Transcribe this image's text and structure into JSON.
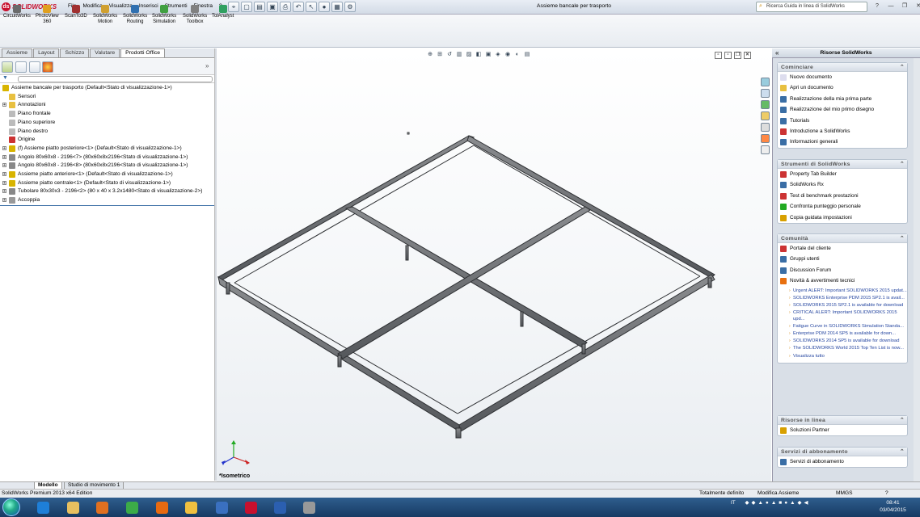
{
  "app": {
    "logo": "SOLIDWORKS",
    "menu": [
      "File",
      "Modifica",
      "Visualizza",
      "Inserisci",
      "Strumenti",
      "Finestra",
      "?"
    ],
    "document_title": "Assieme bancale per trasporto",
    "search_placeholder": "Ricerca Guida in linea di SolidWorks"
  },
  "commands": [
    {
      "label": "CircuitWorks",
      "color": "#6a6a6a"
    },
    {
      "label": "PhotoView\n360",
      "color": "#e0a020"
    },
    {
      "label": "ScanTo3D",
      "color": "#a03030"
    },
    {
      "label": "SolidWorks\nMotion",
      "color": "#d0a030"
    },
    {
      "label": "SolidWorks\nRouting",
      "color": "#3070b0"
    },
    {
      "label": "SolidWorks\nSimulation",
      "color": "#40a040"
    },
    {
      "label": "SolidWorks\nToolbox",
      "color": "#808080"
    },
    {
      "label": "TolAnalyst",
      "color": "#30a060"
    }
  ],
  "tabs": [
    "Assieme",
    "Layout",
    "Schizzo",
    "Valutare",
    "Prodotti Office"
  ],
  "active_tab": "Prodotti Office",
  "tree": [
    {
      "label": "Assieme bancale per trasporto  (Default<Stato di visualizzazione-1>)",
      "indent": 0,
      "icon": "assembly-icon",
      "color": "#d8b400"
    },
    {
      "label": "Sensori",
      "indent": 1,
      "icon": "sensor-icon",
      "color": "#e8c040"
    },
    {
      "label": "Annotazioni",
      "indent": 1,
      "icon": "annotation-icon",
      "color": "#e8c040",
      "exp": "+"
    },
    {
      "label": "Piano frontale",
      "indent": 1,
      "icon": "plane-icon",
      "color": "#bbb"
    },
    {
      "label": "Piano superiore",
      "indent": 1,
      "icon": "plane-icon",
      "color": "#bbb"
    },
    {
      "label": "Piano destro",
      "indent": 1,
      "icon": "plane-icon",
      "color": "#bbb"
    },
    {
      "label": "Origine",
      "indent": 1,
      "icon": "origin-icon",
      "color": "#c33"
    },
    {
      "label": "(f) Assieme piatto posteriore<1> (Default<Stato di visualizzazione-1>)",
      "indent": 1,
      "icon": "subassembly-icon",
      "color": "#d8b400",
      "exp": "+"
    },
    {
      "label": "Angolo 80x60x8 - 2196<7> (80x60x8x2196<Stato di visualizzazione-1>)",
      "indent": 1,
      "icon": "part-icon",
      "color": "#888",
      "exp": "+"
    },
    {
      "label": "Angolo 80x60x8 - 2196<8> (80x60x8x2196<Stato di visualizzazione-1>)",
      "indent": 1,
      "icon": "part-icon",
      "color": "#888",
      "exp": "+"
    },
    {
      "label": "Assieme piatto anteriore<1> (Default<Stato di visualizzazione-1>)",
      "indent": 1,
      "icon": "subassembly-icon",
      "color": "#d8b400",
      "exp": "+"
    },
    {
      "label": "Assieme piatto centrale<1> (Default<Stato di visualizzazione-1>)",
      "indent": 1,
      "icon": "subassembly-icon",
      "color": "#d8b400",
      "exp": "+"
    },
    {
      "label": "Tubolare 80x30x3 - 2196<2> (80 x 40 x 3.2x1480<Stato di visualizzazione-2>)",
      "indent": 1,
      "icon": "part-icon",
      "color": "#888",
      "exp": "+"
    },
    {
      "label": "Accoppia",
      "indent": 1,
      "icon": "mate-icon",
      "color": "#999",
      "exp": "+"
    }
  ],
  "viewport": {
    "view_label": "*Isometrico"
  },
  "task_pane": {
    "title": "Risorse SolidWorks",
    "sections": [
      {
        "title": "Cominciare",
        "items": [
          {
            "label": "Nuovo documento",
            "color": "#dde"
          },
          {
            "label": "Apri un documento",
            "color": "#e8c040"
          },
          {
            "label": "Realizzazione della mia prima parte",
            "color": "#3a6ea5"
          },
          {
            "label": "Realizzazione del mio primo disegno",
            "color": "#3a6ea5"
          },
          {
            "label": "Tutorials",
            "color": "#3a6ea5"
          },
          {
            "label": "Introduzione a SolidWorks",
            "color": "#c33"
          },
          {
            "label": "Informazioni generali",
            "color": "#3a6ea5"
          }
        ]
      },
      {
        "title": "Strumenti di SolidWorks",
        "items": [
          {
            "label": "Property Tab Builder",
            "color": "#c33"
          },
          {
            "label": "SolidWorks Rx",
            "color": "#3a6ea5"
          },
          {
            "label": "Test di benchmark prestazioni",
            "color": "#c33"
          },
          {
            "label": "Confronta punteggio personale",
            "color": "#2a2"
          },
          {
            "label": "Copia guidata impostazioni",
            "color": "#d8a000"
          }
        ]
      },
      {
        "title": "Comunità",
        "items": [
          {
            "label": "Portale del cliente",
            "color": "#c33"
          },
          {
            "label": "Gruppi utenti",
            "color": "#3a6ea5"
          },
          {
            "label": "Discussion Forum",
            "color": "#3a6ea5"
          },
          {
            "label": "Novità & avvertimenti tecnici",
            "color": "#e87010"
          }
        ],
        "news": [
          "Urgent ALERT: Important SOLIDWORKS 2015 updat...",
          "SOLIDWORKS Enterprise PDM 2015 SP2.1 is avail...",
          "SOLIDWORKS 2015 SP2.1 is available for download",
          "CRITICAL ALERT: Important SOLIDWORKS 2015 upd...",
          "Fatigue Curve in SOLIDWORKS Simulation Standa...",
          "Enterprise PDM 2014 SP5 is available for down...",
          "SOLIDWORKS 2014 SP5 is available for download",
          "The SOLIDWORKS World 2015 Top Ten List is now...",
          "Visualizza tutto"
        ]
      },
      {
        "title": "Risorse in linea",
        "items": [
          {
            "label": "Soluzioni Partner",
            "color": "#d8a000"
          }
        ]
      },
      {
        "title": "Servizi di abbonamento",
        "items": [
          {
            "label": "Servizi di abbonamento",
            "color": "#3a6ea5"
          }
        ]
      }
    ]
  },
  "bottom_tabs": [
    "Modello",
    "Studio di movimento 1"
  ],
  "status": {
    "edition": "SolidWorks Premium 2013 x64 Edition",
    "state": "Totalmente definito",
    "mode": "Modifica Assieme",
    "units": "MMGS",
    "help": "?"
  },
  "taskbar": {
    "apps": [
      {
        "name": "internet-explorer",
        "color": "#1e7fd8"
      },
      {
        "name": "file-explorer",
        "color": "#e8c060"
      },
      {
        "name": "media-player",
        "color": "#e07020"
      },
      {
        "name": "chrome",
        "color": "#3cab48"
      },
      {
        "name": "firefox",
        "color": "#e86a10"
      },
      {
        "name": "folder",
        "color": "#f0c040"
      },
      {
        "name": "thunderbird",
        "color": "#3a70c0"
      },
      {
        "name": "solidworks",
        "color": "#c8102e"
      },
      {
        "name": "word",
        "color": "#2b5fb0"
      },
      {
        "name": "tool",
        "color": "#999"
      }
    ],
    "lang": "IT",
    "time": "08:41",
    "date": "03/04/2015"
  }
}
